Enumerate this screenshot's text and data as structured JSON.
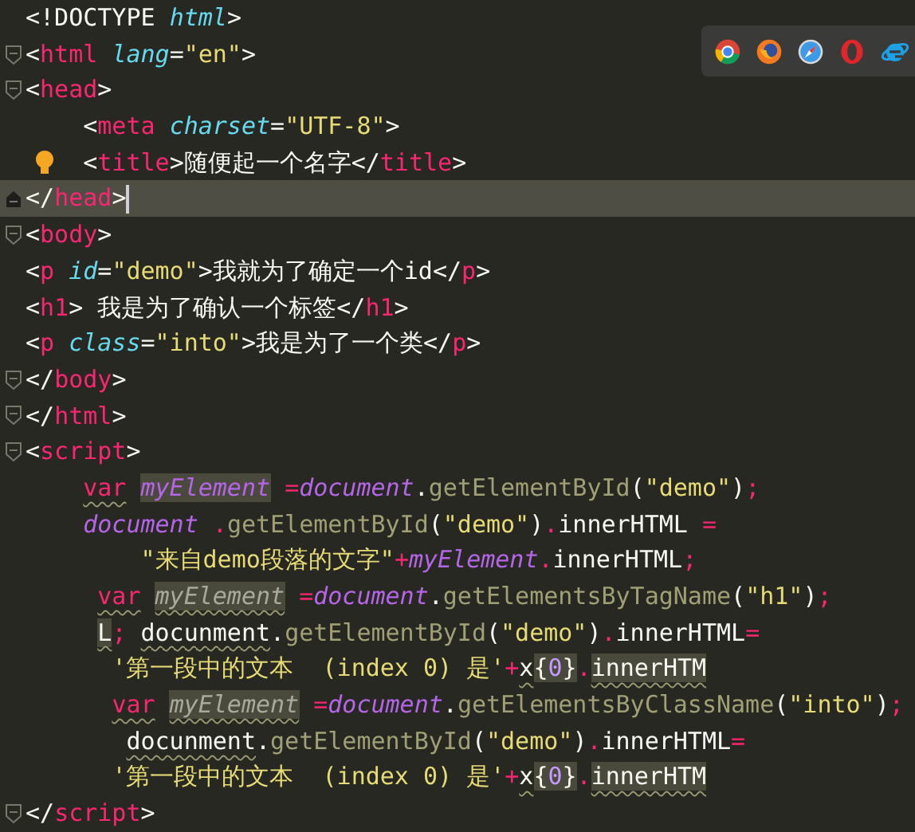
{
  "editor": {
    "lines": [
      {
        "tokens": [
          {
            "t": "<!DOCTYPE",
            "kind": "p"
          },
          {
            "t": " html",
            "kind": "attr"
          },
          {
            "t": ">",
            "kind": "p"
          }
        ]
      },
      {
        "kind": "fold",
        "tokens": [
          {
            "t": "<",
            "kind": "p"
          },
          {
            "t": "html",
            "kind": "tag"
          },
          {
            "t": " lang",
            "kind": "attr"
          },
          {
            "t": "=",
            "kind": "p"
          },
          {
            "t": "\"en\"",
            "kind": "str"
          },
          {
            "t": ">",
            "kind": "p"
          }
        ]
      },
      {
        "kind": "fold",
        "tokens": [
          {
            "t": "<",
            "kind": "p"
          },
          {
            "t": "head",
            "kind": "tag"
          },
          {
            "t": ">",
            "kind": "p"
          }
        ]
      },
      {
        "tokens": [
          {
            "t": "    <",
            "kind": "p"
          },
          {
            "t": "meta",
            "kind": "tag"
          },
          {
            "t": " charset",
            "kind": "attr"
          },
          {
            "t": "=",
            "kind": "p"
          },
          {
            "t": "\"UTF-8\"",
            "kind": "str"
          },
          {
            "t": ">",
            "kind": "p"
          }
        ]
      },
      {
        "kind": "bulb",
        "tokens": [
          {
            "t": "    <",
            "kind": "p"
          },
          {
            "t": "title",
            "kind": "tag"
          },
          {
            "t": ">",
            "kind": "p"
          },
          {
            "t": "随便起一个名字",
            "kind": "p"
          },
          {
            "t": "</",
            "kind": "p"
          },
          {
            "t": "title",
            "kind": "tag"
          },
          {
            "t": ">",
            "kind": "p"
          }
        ]
      },
      {
        "kind": "lock",
        "current": true,
        "tokens": [
          {
            "t": "</",
            "kind": "p"
          },
          {
            "t": "head",
            "kind": "tag"
          },
          {
            "t": ">",
            "kind": "p"
          }
        ]
      },
      {
        "kind": "fold",
        "tokens": [
          {
            "t": "<",
            "kind": "p"
          },
          {
            "t": "body",
            "kind": "tag"
          },
          {
            "t": ">",
            "kind": "p"
          }
        ]
      },
      {
        "tokens": [
          {
            "t": "<",
            "kind": "p"
          },
          {
            "t": "p",
            "kind": "tag"
          },
          {
            "t": " id",
            "kind": "attr"
          },
          {
            "t": "=",
            "kind": "p"
          },
          {
            "t": "\"demo\"",
            "kind": "str"
          },
          {
            "t": ">",
            "kind": "p"
          },
          {
            "t": "我就为了确定一个id",
            "kind": "p"
          },
          {
            "t": "</",
            "kind": "p"
          },
          {
            "t": "p",
            "kind": "tag"
          },
          {
            "t": ">",
            "kind": "p"
          }
        ]
      },
      {
        "tokens": [
          {
            "t": "<",
            "kind": "p"
          },
          {
            "t": "h1",
            "kind": "tag"
          },
          {
            "t": ">",
            "kind": "p"
          },
          {
            "t": " 我是为了确认一个标签",
            "kind": "p"
          },
          {
            "t": "</",
            "kind": "p"
          },
          {
            "t": "h1",
            "kind": "tag"
          },
          {
            "t": ">",
            "kind": "p"
          }
        ]
      },
      {
        "tokens": [
          {
            "t": "<",
            "kind": "p"
          },
          {
            "t": "p",
            "kind": "tag"
          },
          {
            "t": " class",
            "kind": "attr"
          },
          {
            "t": "=",
            "kind": "p"
          },
          {
            "t": "\"into\"",
            "kind": "str"
          },
          {
            "t": ">",
            "kind": "p"
          },
          {
            "t": "我是为了一个类",
            "kind": "p"
          },
          {
            "t": "</",
            "kind": "p"
          },
          {
            "t": "p",
            "kind": "tag"
          },
          {
            "t": ">",
            "kind": "p"
          }
        ]
      },
      {
        "kind": "fold",
        "tokens": [
          {
            "t": "</",
            "kind": "p"
          },
          {
            "t": "body",
            "kind": "tag"
          },
          {
            "t": ">",
            "kind": "p"
          }
        ]
      },
      {
        "kind": "fold",
        "tokens": [
          {
            "t": "</",
            "kind": "p"
          },
          {
            "t": "html",
            "kind": "tag"
          },
          {
            "t": ">",
            "kind": "p"
          }
        ]
      },
      {
        "kind": "fold",
        "tokens": [
          {
            "t": "<",
            "kind": "p"
          },
          {
            "t": "script",
            "kind": "tag"
          },
          {
            "t": ">",
            "kind": "p"
          }
        ]
      },
      {
        "tokens": [
          {
            "t": "    var",
            "kind": "tag",
            "warn": true
          },
          {
            "t": " myElement",
            "kind": "var",
            "hl": true
          },
          {
            "t": " =",
            "kind": "tag"
          },
          {
            "t": "document",
            "kind": "var"
          },
          {
            "t": ".",
            "kind": "p"
          },
          {
            "t": "getElementById",
            "kind": "fn"
          },
          {
            "t": "(",
            "kind": "p"
          },
          {
            "t": "\"demo\"",
            "kind": "str"
          },
          {
            "t": ")",
            "kind": "p"
          },
          {
            "t": ";",
            "kind": "tag"
          }
        ]
      },
      {
        "tokens": [
          {
            "t": "    document",
            "kind": "var"
          },
          {
            "t": " .",
            "kind": "tag"
          },
          {
            "t": "getElementById",
            "kind": "fn"
          },
          {
            "t": "(",
            "kind": "p"
          },
          {
            "t": "\"demo\"",
            "kind": "str"
          },
          {
            "t": ")",
            "kind": "p"
          },
          {
            "t": ".",
            "kind": "tag"
          },
          {
            "t": "innerHTML",
            "kind": "p"
          },
          {
            "t": " =",
            "kind": "tag"
          }
        ]
      },
      {
        "tokens": [
          {
            "t": "        \"来自demo段落的文字\"",
            "kind": "str"
          },
          {
            "t": "+",
            "kind": "tag"
          },
          {
            "t": "myElement",
            "kind": "var"
          },
          {
            "t": ".",
            "kind": "tag"
          },
          {
            "t": "innerHTML",
            "kind": "p"
          },
          {
            "t": ";",
            "kind": "tag"
          }
        ]
      },
      {
        "tokens": [
          {
            "t": "     var",
            "kind": "tag",
            "warn": true
          },
          {
            "t": " myElement",
            "kind": "dim",
            "hl": true,
            "warn": true
          },
          {
            "t": " =",
            "kind": "tag"
          },
          {
            "t": "document",
            "kind": "var"
          },
          {
            "t": ".",
            "kind": "p"
          },
          {
            "t": "getElementsByTagName",
            "kind": "fn"
          },
          {
            "t": "(",
            "kind": "p"
          },
          {
            "t": "\"h1\"",
            "kind": "str"
          },
          {
            "t": ")",
            "kind": "p"
          },
          {
            "t": ";",
            "kind": "tag"
          }
        ]
      },
      {
        "tokens": [
          {
            "t": "     L",
            "kind": "p",
            "hl": true,
            "warn": true
          },
          {
            "t": ";",
            "kind": "tag"
          },
          {
            "t": " docunment",
            "kind": "p",
            "warn": true
          },
          {
            "t": ".",
            "kind": "p"
          },
          {
            "t": "getElementById",
            "kind": "fn"
          },
          {
            "t": "(",
            "kind": "p"
          },
          {
            "t": "\"demo\"",
            "kind": "str"
          },
          {
            "t": ")",
            "kind": "p"
          },
          {
            "t": ".",
            "kind": "tag"
          },
          {
            "t": "innerHTML",
            "kind": "p"
          },
          {
            "t": "=",
            "kind": "tag"
          }
        ]
      },
      {
        "tokens": [
          {
            "t": "      '第一段中的文本  (index 0) 是'",
            "kind": "str"
          },
          {
            "t": "+",
            "kind": "tag"
          },
          {
            "t": "x",
            "kind": "p",
            "warn": true
          },
          {
            "t": "{",
            "kind": "p",
            "hl": true
          },
          {
            "t": "0",
            "kind": "num",
            "hl": true
          },
          {
            "t": "}",
            "kind": "p",
            "hl": true
          },
          {
            "t": ".",
            "kind": "tag"
          },
          {
            "t": "innerHTM",
            "kind": "p",
            "hl": true,
            "warn": true
          }
        ]
      },
      {
        "tokens": [
          {
            "t": "      var",
            "kind": "tag",
            "warn": true
          },
          {
            "t": " myElement",
            "kind": "dim",
            "hl": true,
            "warn": true
          },
          {
            "t": " =",
            "kind": "tag"
          },
          {
            "t": "document",
            "kind": "var"
          },
          {
            "t": ".",
            "kind": "p"
          },
          {
            "t": "getElementsByClassName",
            "kind": "fn"
          },
          {
            "t": "(",
            "kind": "p"
          },
          {
            "t": "\"into\"",
            "kind": "str"
          },
          {
            "t": ")",
            "kind": "p"
          },
          {
            "t": ";",
            "kind": "tag"
          }
        ]
      },
      {
        "tokens": [
          {
            "t": "       docunment",
            "kind": "p",
            "warn": true
          },
          {
            "t": ".",
            "kind": "p"
          },
          {
            "t": "getElementById",
            "kind": "fn"
          },
          {
            "t": "(",
            "kind": "p"
          },
          {
            "t": "\"demo\"",
            "kind": "str"
          },
          {
            "t": ")",
            "kind": "p"
          },
          {
            "t": ".",
            "kind": "tag"
          },
          {
            "t": "innerHTML",
            "kind": "p"
          },
          {
            "t": "=",
            "kind": "tag"
          }
        ]
      },
      {
        "tokens": [
          {
            "t": "      '第一段中的文本  (index 0) 是'",
            "kind": "str"
          },
          {
            "t": "+",
            "kind": "tag"
          },
          {
            "t": "x",
            "kind": "p",
            "warn": true
          },
          {
            "t": "{",
            "kind": "p",
            "hl": true
          },
          {
            "t": "0",
            "kind": "num",
            "hl": true
          },
          {
            "t": "}",
            "kind": "p",
            "hl": true
          },
          {
            "t": ".",
            "kind": "tag"
          },
          {
            "t": "innerHTM",
            "kind": "p",
            "hl": true,
            "warn": true
          }
        ]
      },
      {
        "kind": "fold",
        "tokens": [
          {
            "t": "</",
            "kind": "p"
          },
          {
            "t": "script",
            "kind": "tag"
          },
          {
            "t": ">",
            "kind": "p"
          }
        ]
      }
    ]
  },
  "browser_bar": {
    "browsers": [
      {
        "kind": "chrome"
      },
      {
        "kind": "firefox"
      },
      {
        "kind": "safari"
      },
      {
        "kind": "opera"
      },
      {
        "kind": "ie"
      }
    ]
  }
}
